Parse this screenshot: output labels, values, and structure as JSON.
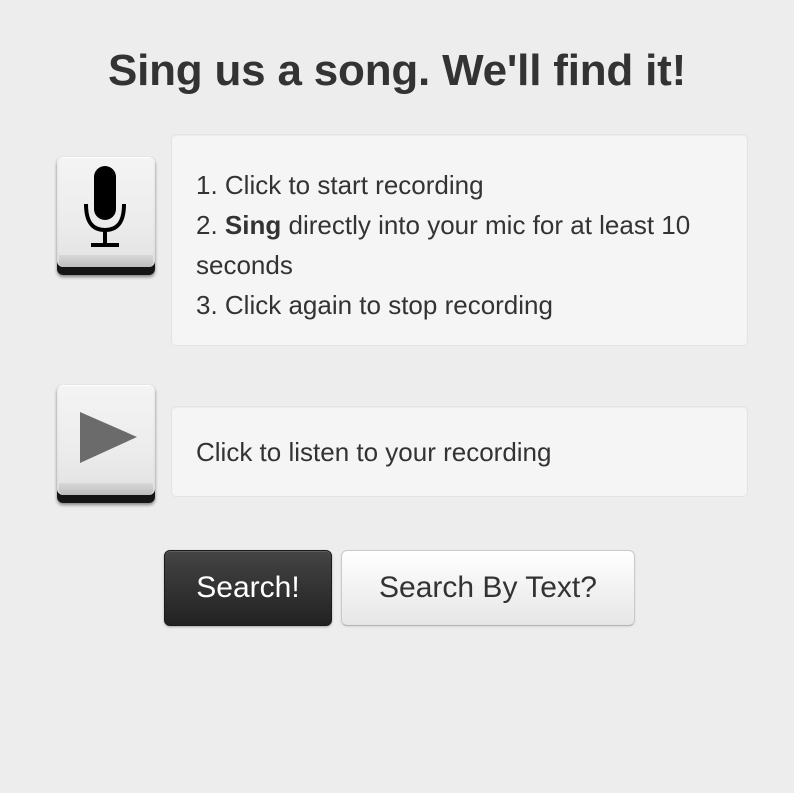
{
  "page": {
    "title": "Sing us a song. We'll find it!"
  },
  "record": {
    "icon": "microphone-icon",
    "steps": {
      "step1": "1. Click to start recording",
      "step2_prefix": "2. ",
      "step2_bold": "Sing",
      "step2_rest": " directly into your mic for at least 10 seconds",
      "step3": "3. Click again to stop recording"
    }
  },
  "playback": {
    "icon": "play-icon",
    "text": "Click to listen to your recording"
  },
  "actions": {
    "search_label": "Search!",
    "search_text_label": "Search By Text?"
  },
  "colors": {
    "background": "#ededed",
    "panel": "#f5f5f5",
    "primary_button": "#2b2b2b",
    "text": "#333333"
  }
}
